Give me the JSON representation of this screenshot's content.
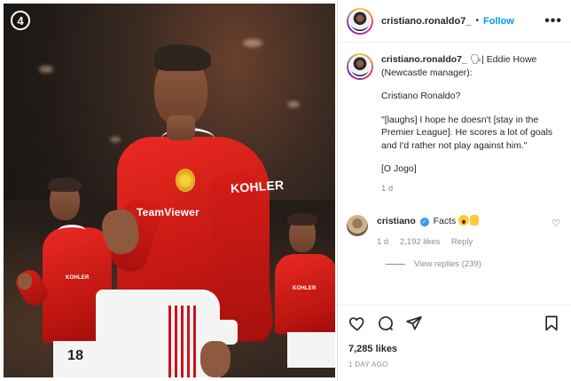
{
  "photo": {
    "badge_number": "4",
    "shirt_sponsor": "KOHLER",
    "sleeve_sponsor": "TeamViewer",
    "back_number": "18"
  },
  "header": {
    "username": "cristiano.ronaldo7_",
    "separator": "•",
    "follow_label": "Follow",
    "more_label": "•••"
  },
  "caption": {
    "username": "cristiano.ronaldo7_",
    "lines": [
      "Eddie Howe (Newcastle manager):",
      "Cristiano Ronaldo?",
      "\"[laughs] I hope he doesn't [stay in the Premier League]. He scores a lot of goals and I'd rather not play against him.\"",
      "[O Jogo]"
    ],
    "age": "1 d"
  },
  "comment": {
    "username": "cristiano",
    "text": "Facts",
    "age": "1 d",
    "likes": "2,192 likes",
    "reply_label": "Reply",
    "view_replies": "View replies (239)"
  },
  "actions": {
    "likes": "7,285 likes",
    "date": "1 DAY AGO"
  }
}
